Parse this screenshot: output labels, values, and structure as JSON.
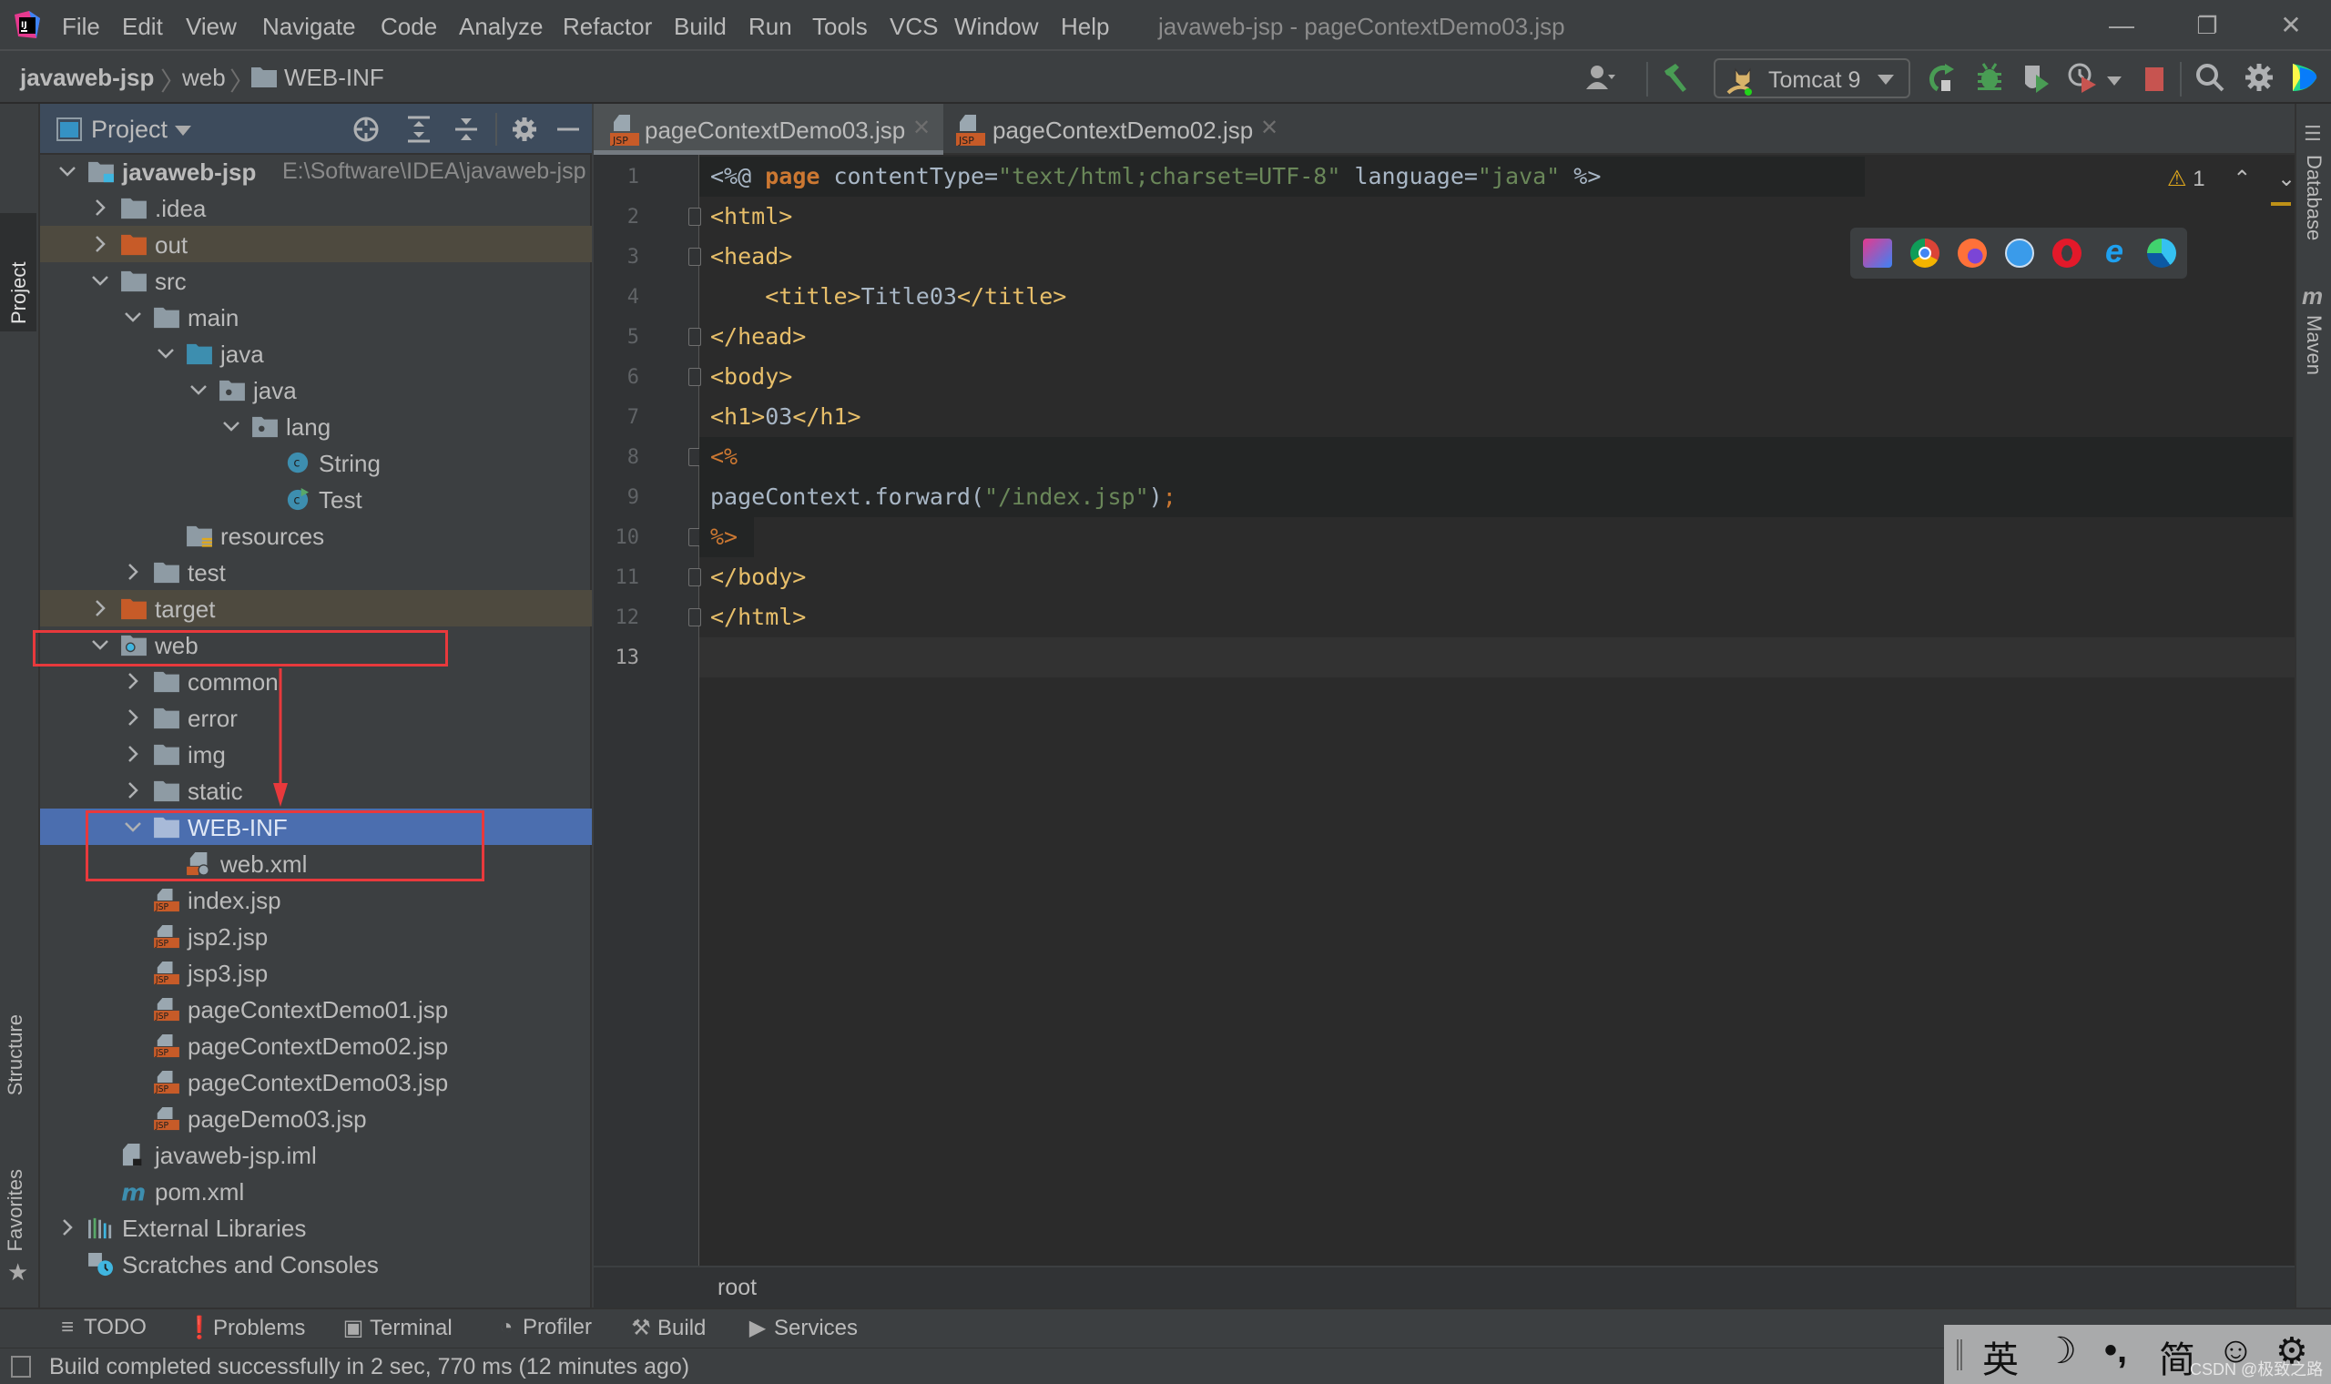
{
  "window": {
    "title": "javaweb-jsp - pageContextDemo03.jsp",
    "minimize": "—",
    "restore": "❐",
    "close": "✕"
  },
  "menu": [
    "File",
    "Edit",
    "View",
    "Navigate",
    "Code",
    "Analyze",
    "Refactor",
    "Build",
    "Run",
    "Tools",
    "VCS",
    "Window",
    "Help"
  ],
  "breadcrumb": [
    "javaweb-jsp",
    "web",
    "WEB-INF"
  ],
  "toolbar": {
    "run_config": "Tomcat 9",
    "icons": [
      "user-icon",
      "build-hammer-icon",
      "rerun-icon",
      "debug-icon",
      "coverage-icon",
      "profile-icon",
      "stop-icon",
      "search-icon",
      "settings-icon",
      "toolbox-icon"
    ]
  },
  "left_stripe": {
    "project": "Project",
    "structure": "Structure",
    "favorites": "Favorites"
  },
  "right_stripe": {
    "database": "Database",
    "maven": "Maven"
  },
  "project_panel": {
    "title": "Project",
    "tree": [
      {
        "label": "javaweb-jsp",
        "path": "E:\\Software\\IDEA\\javaweb-jsp",
        "depth": 0,
        "expanded": true,
        "icon": "module-folder-icon",
        "bold": true
      },
      {
        "label": ".idea",
        "depth": 1,
        "expanded": false,
        "icon": "folder-icon"
      },
      {
        "label": "out",
        "depth": 1,
        "expanded": false,
        "icon": "excluded-folder-icon",
        "ignored": true
      },
      {
        "label": "src",
        "depth": 1,
        "expanded": true,
        "icon": "folder-icon"
      },
      {
        "label": "main",
        "depth": 2,
        "expanded": true,
        "icon": "folder-icon"
      },
      {
        "label": "java",
        "depth": 3,
        "expanded": true,
        "icon": "source-root-icon"
      },
      {
        "label": "java",
        "depth": 4,
        "expanded": true,
        "icon": "package-icon"
      },
      {
        "label": "lang",
        "depth": 5,
        "expanded": true,
        "icon": "package-icon"
      },
      {
        "label": "String",
        "depth": 6,
        "icon": "class-icon"
      },
      {
        "label": "Test",
        "depth": 6,
        "icon": "runnable-class-icon"
      },
      {
        "label": "resources",
        "depth": 3,
        "icon": "resources-folder-icon"
      },
      {
        "label": "test",
        "depth": 2,
        "expanded": false,
        "icon": "folder-icon"
      },
      {
        "label": "target",
        "depth": 1,
        "expanded": false,
        "icon": "excluded-folder-icon",
        "ignored": true
      },
      {
        "label": "web",
        "depth": 1,
        "expanded": true,
        "icon": "web-folder-icon"
      },
      {
        "label": "common",
        "depth": 2,
        "expanded": false,
        "icon": "folder-icon"
      },
      {
        "label": "error",
        "depth": 2,
        "expanded": false,
        "icon": "folder-icon"
      },
      {
        "label": "img",
        "depth": 2,
        "expanded": false,
        "icon": "folder-icon"
      },
      {
        "label": "static",
        "depth": 2,
        "expanded": false,
        "icon": "folder-icon"
      },
      {
        "label": "WEB-INF",
        "depth": 2,
        "expanded": true,
        "icon": "folder-icon",
        "selected": true
      },
      {
        "label": "web.xml",
        "depth": 3,
        "icon": "xml-file-icon"
      },
      {
        "label": "index.jsp",
        "depth": 2,
        "icon": "jsp-file-icon"
      },
      {
        "label": "jsp2.jsp",
        "depth": 2,
        "icon": "jsp-file-icon"
      },
      {
        "label": "jsp3.jsp",
        "depth": 2,
        "icon": "jsp-file-icon"
      },
      {
        "label": "pageContextDemo01.jsp",
        "depth": 2,
        "icon": "jsp-file-icon"
      },
      {
        "label": "pageContextDemo02.jsp",
        "depth": 2,
        "icon": "jsp-file-icon"
      },
      {
        "label": "pageContextDemo03.jsp",
        "depth": 2,
        "icon": "jsp-file-icon"
      },
      {
        "label": "pageDemo03.jsp",
        "depth": 2,
        "icon": "jsp-file-icon"
      },
      {
        "label": "javaweb-jsp.iml",
        "depth": 1,
        "icon": "iml-file-icon"
      },
      {
        "label": "pom.xml",
        "depth": 1,
        "icon": "maven-icon"
      },
      {
        "label": "External Libraries",
        "depth": 0,
        "expanded": false,
        "icon": "libraries-icon"
      },
      {
        "label": "Scratches and Consoles",
        "depth": 0,
        "icon": "scratches-icon"
      }
    ]
  },
  "editor": {
    "tabs": [
      {
        "label": "pageContextDemo03.jsp",
        "active": true
      },
      {
        "label": "pageContextDemo02.jsp",
        "active": false
      }
    ],
    "warnings": "1",
    "lines": [
      [
        [
          "t-txt",
          "<%@ "
        ],
        [
          "t-kw",
          "page"
        ],
        [
          "t-txt",
          " contentType="
        ],
        [
          "t-str",
          "\"text/html;charset=UTF-8\""
        ],
        [
          "t-txt",
          " language="
        ],
        [
          "t-str",
          "\"java\""
        ],
        [
          "t-txt",
          " %>"
        ]
      ],
      [
        [
          "t-tag",
          "<html>"
        ]
      ],
      [
        [
          "t-tag",
          "<head>"
        ]
      ],
      [
        [
          "t-txt",
          "    "
        ],
        [
          "t-tag",
          "<title>"
        ],
        [
          "t-txt",
          "Title03"
        ],
        [
          "t-tag",
          "</title>"
        ]
      ],
      [
        [
          "t-tag",
          "</head>"
        ]
      ],
      [
        [
          "t-tag",
          "<body>"
        ]
      ],
      [
        [
          "t-tag",
          "<h1>"
        ],
        [
          "t-txt",
          "03"
        ],
        [
          "t-tag",
          "</h1>"
        ]
      ],
      [
        [
          "t-op",
          "<%"
        ]
      ],
      [
        [
          "t-txt",
          "pageContext.forward("
        ],
        [
          "t-str",
          "\"/index.jsp\""
        ],
        [
          "t-txt",
          ")"
        ],
        [
          "t-op",
          ";"
        ]
      ],
      [
        [
          "t-op",
          "%>"
        ]
      ],
      [
        [
          "t-tag",
          "</body>"
        ]
      ],
      [
        [
          "t-tag",
          "</html>"
        ]
      ],
      []
    ],
    "breadcrumb": "root"
  },
  "browsers": [
    "intellij-icon",
    "chrome-icon",
    "firefox-icon",
    "safari-icon",
    "opera-icon",
    "ie-icon",
    "edge-icon"
  ],
  "bottom_tools": [
    {
      "label": "TODO",
      "icon": "≡"
    },
    {
      "label": "Problems",
      "icon": "❗"
    },
    {
      "label": "Terminal",
      "icon": "▣"
    },
    {
      "label": "Profiler",
      "icon": "◔"
    },
    {
      "label": "Build",
      "icon": "⚒"
    },
    {
      "label": "Services",
      "icon": "▶"
    }
  ],
  "status": {
    "text": "Build completed successfully in 2 sec, 770 ms (12 minutes ago)"
  },
  "ime": {
    "lang": "英",
    "moon": "☽",
    "punct": "•,",
    "simp": "简",
    "emoji": "☺",
    "settings": "⚙"
  },
  "watermark": "CSDN @极致之路",
  "colors": {
    "accent_selection": "#4b6eaf",
    "annotation_red": "#e8393c",
    "jsp_orange": "#c75b28"
  }
}
